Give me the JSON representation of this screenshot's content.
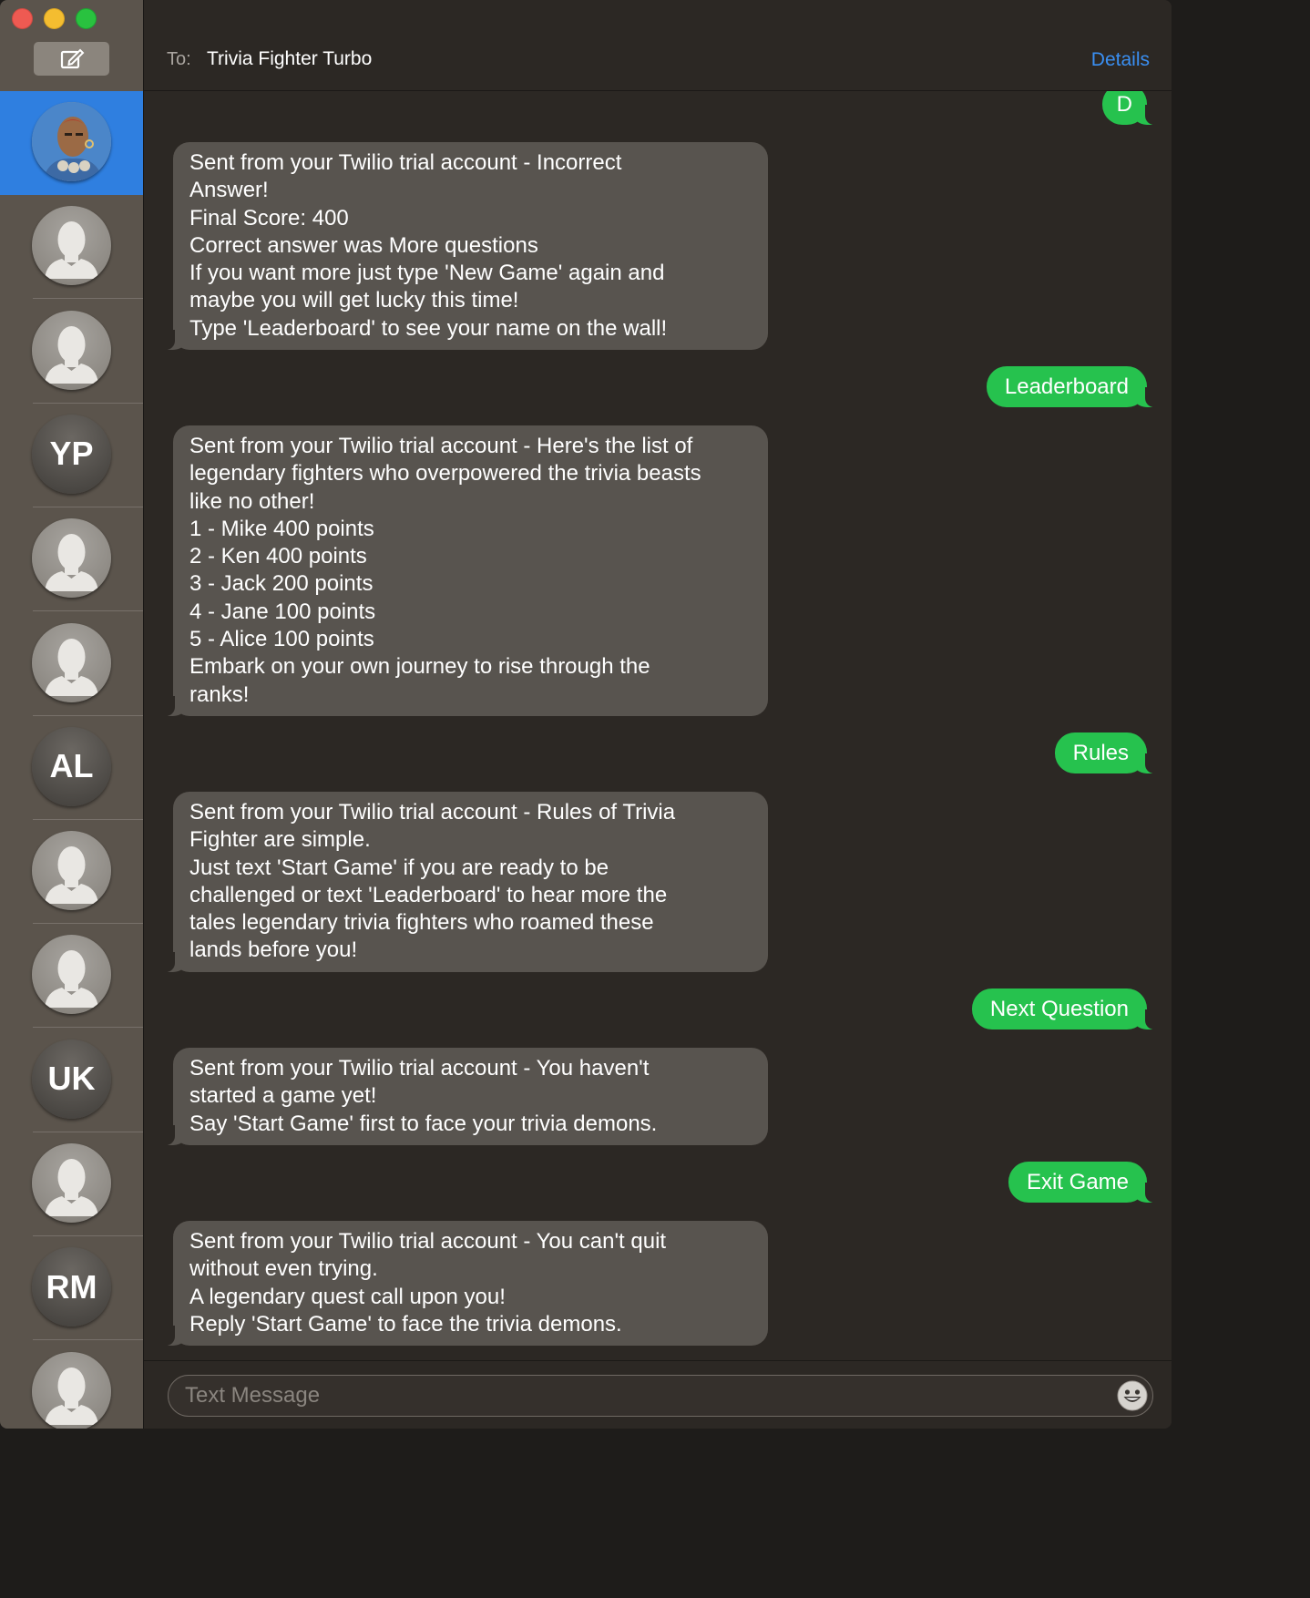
{
  "header": {
    "to_label": "To:",
    "recipient": "Trivia Fighter Turbo",
    "details_label": "Details"
  },
  "sidebar": {
    "conversations": [
      {
        "type": "photo",
        "selected": true
      },
      {
        "type": "silhouette"
      },
      {
        "type": "silhouette"
      },
      {
        "type": "initials",
        "initials": "YP"
      },
      {
        "type": "silhouette"
      },
      {
        "type": "silhouette"
      },
      {
        "type": "initials",
        "initials": "AL"
      },
      {
        "type": "silhouette"
      },
      {
        "type": "silhouette"
      },
      {
        "type": "initials",
        "initials": "UK"
      },
      {
        "type": "silhouette"
      },
      {
        "type": "initials",
        "initials": "RM"
      },
      {
        "type": "silhouette"
      }
    ]
  },
  "messages": [
    {
      "dir": "out",
      "text": "D"
    },
    {
      "dir": "in",
      "text": "Sent from your Twilio trial account - Incorrect\nAnswer!\nFinal Score: 400\nCorrect answer was More questions\nIf you want more just type 'New Game' again and\nmaybe you will get lucky this time!\nType 'Leaderboard' to see your name on the wall!"
    },
    {
      "dir": "out",
      "text": "Leaderboard"
    },
    {
      "dir": "in",
      "text": "Sent from your Twilio trial account - Here's the list of\nlegendary fighters who overpowered the trivia beasts\nlike no other!\n1 - Mike 400 points\n2 - Ken 400 points\n3 - Jack 200 points\n4 - Jane 100 points\n5 - Alice 100 points\nEmbark on your own journey to rise through the\nranks!"
    },
    {
      "dir": "out",
      "text": "Rules"
    },
    {
      "dir": "in",
      "text": "Sent from your Twilio trial account - Rules of Trivia\nFighter are simple.\nJust text 'Start Game' if you are ready to be\nchallenged or text 'Leaderboard' to hear more the\ntales legendary trivia fighters who roamed these\nlands before you!"
    },
    {
      "dir": "out",
      "text": "Next Question"
    },
    {
      "dir": "in",
      "text": "Sent from your Twilio trial account - You haven't\nstarted a game yet!\nSay 'Start Game' first to face your trivia demons."
    },
    {
      "dir": "out",
      "text": "Exit Game"
    },
    {
      "dir": "in",
      "text": "Sent from your Twilio trial account - You can't quit\nwithout even trying.\nA legendary quest call upon you!\nReply 'Start Game' to face the trivia demons."
    }
  ],
  "composer": {
    "placeholder": "Text Message",
    "value": ""
  },
  "colors": {
    "sent_bubble": "#26c24e",
    "received_bubble": "#58544f",
    "selected_row": "#2f7fe0",
    "link": "#3a8ff2"
  }
}
